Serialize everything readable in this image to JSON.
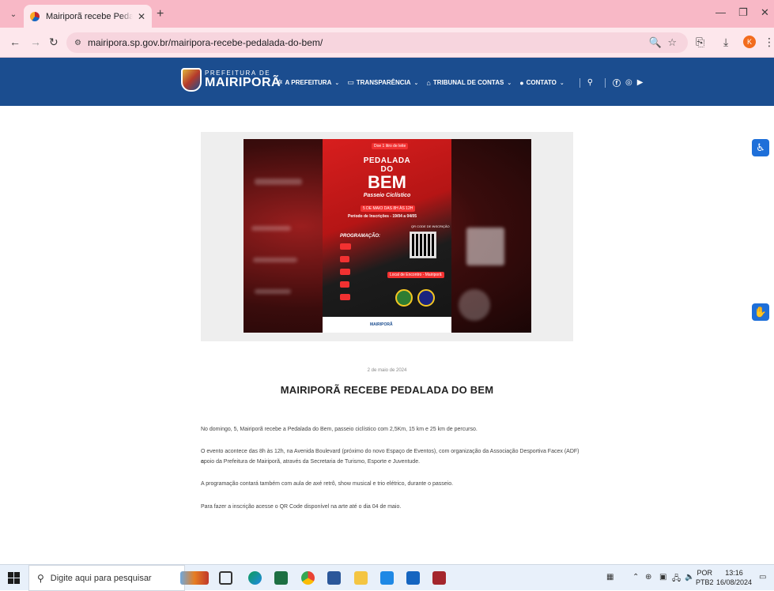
{
  "browser": {
    "tab_title": "Mairiporã recebe Pedalada do Bem",
    "url": "mairipora.sp.gov.br/mairipora-recebe-pedalada-do-bem/",
    "profile_initial": "K"
  },
  "site": {
    "logo_small": "PREFEITURA DE",
    "logo_big": "MAIRIPORÃ",
    "nav": [
      {
        "label": "A PREFEITURA",
        "icon": "gear-icon"
      },
      {
        "label": "TRANSPARÊNCIA",
        "icon": "monitor-icon"
      },
      {
        "label": "TRIBUNAL DE CONTAS",
        "icon": "bank-icon"
      },
      {
        "label": "CONTATO",
        "icon": "chat-icon"
      }
    ]
  },
  "poster": {
    "badge": "Doe 1 litro de leite",
    "title_top": "PEDALADA",
    "title_mid": "DO",
    "title_big": "BEM",
    "subtitle": "Passeio Ciclístico",
    "date_line": "5 DE MAIO DAS 8H ÀS 12H",
    "inscricoes": "Período de Inscrições - 19/04 a 04/05",
    "programacao": "PROGRAMAÇÃO:",
    "qr_label": "QR CODE DE INSCRIÇÃO",
    "local": "Local de Encontro - Mairiporã",
    "footer_brand": "MAIRIPORÃ"
  },
  "article": {
    "date": "2 de maio de 2024",
    "title": "MAIRIPORÃ RECEBE PEDALADA DO BEM",
    "p1": "No domingo, 5, Mairiporã recebe a Pedalada do Bem, passeio ciclístico com 2,5Km, 15 km e 25 km de percurso.",
    "p2a": "O evento acontece das 8h às 12h, na Avenida Boulevard (próximo do novo Espaço de Eventos), com organização da Associação Desportiva Facex (ADF) e",
    "p2b": "apoio da Prefeitura de Mairiporã, através da Secretaria de Turismo, Esporte e Juventude.",
    "p3": "A programação contará também com aula de axé retrô, show musical e trio elétrico, durante o passeio.",
    "p4": "Para fazer a inscrição acesse o QR Code disponível na arte até o dia 04 de maio."
  },
  "taskbar": {
    "search_placeholder": "Digite aqui para pesquisar",
    "lang1": "POR",
    "lang2": "PTB2",
    "time": "13:16",
    "date": "16/08/2024"
  },
  "colors": {
    "header_blue": "#1b4d8f",
    "tab_pink": "#f8b8c6",
    "accent_red": "#d81e1e"
  }
}
